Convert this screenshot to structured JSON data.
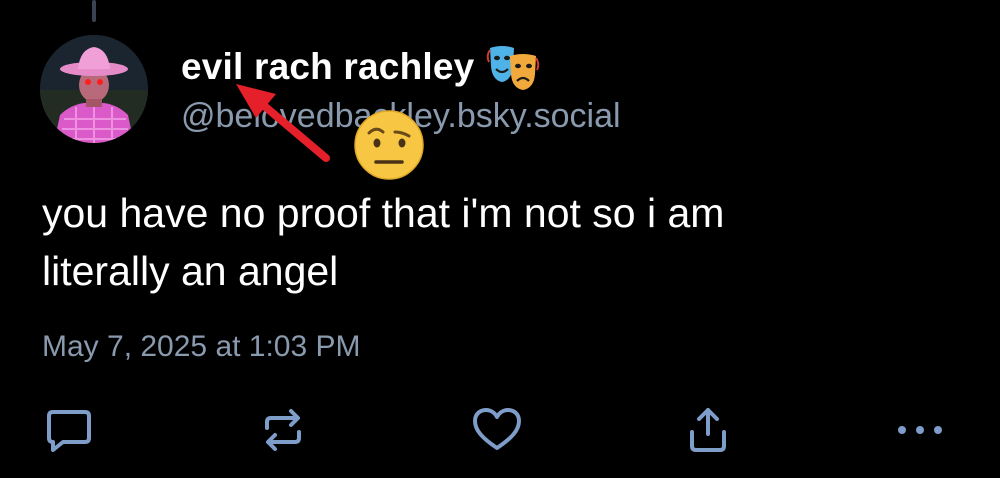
{
  "post": {
    "display_name": "evil rach rachley",
    "name_emoji": "performing-arts-masks",
    "handle": "@belovedbackley.bsky.social",
    "text_line1": "you have no proof that i'm not so i am",
    "text_line2": "literally an angel",
    "timestamp": "May 7, 2025 at 1:03 PM"
  },
  "actions": {
    "reply_icon": "chat-bubble-icon",
    "repost_icon": "repost-arrows-icon",
    "like_icon": "heart-icon",
    "share_icon": "share-upload-icon",
    "more_icon": "ellipsis-icon"
  },
  "overlay": {
    "annotation": "red-arrow-pointing-at-name",
    "reaction_emoji": "face-with-raised-eyebrow"
  },
  "colors": {
    "background": "#000000",
    "primary_text": "#ffffff",
    "secondary_text": "#8a9aae",
    "icon": "#7f9dc9",
    "annotation_red": "#e5202a"
  }
}
